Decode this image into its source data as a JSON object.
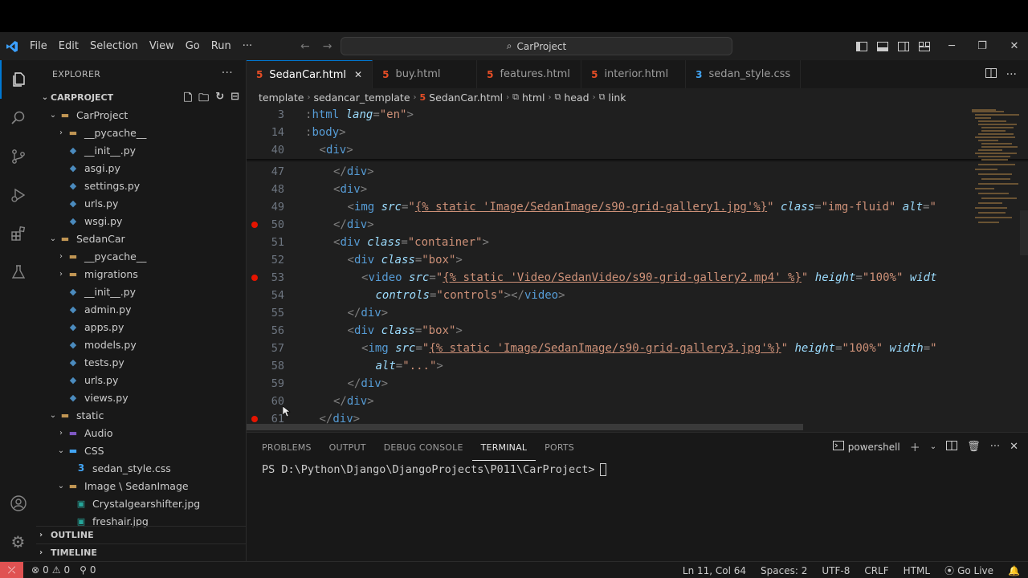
{
  "menu": [
    "File",
    "Edit",
    "Selection",
    "View",
    "Go",
    "Run",
    "···"
  ],
  "search": {
    "text": "CarProject"
  },
  "explorer": {
    "title": "EXPLORER",
    "root": "CARPROJECT",
    "tree": [
      {
        "label": "CarProject",
        "type": "folder",
        "indent": 1,
        "open": true
      },
      {
        "label": "__pycache__",
        "type": "folder",
        "indent": 2,
        "open": false
      },
      {
        "label": "__init__.py",
        "type": "py",
        "indent": 2
      },
      {
        "label": "asgi.py",
        "type": "py",
        "indent": 2
      },
      {
        "label": "settings.py",
        "type": "py",
        "indent": 2
      },
      {
        "label": "urls.py",
        "type": "py",
        "indent": 2
      },
      {
        "label": "wsgi.py",
        "type": "py",
        "indent": 2
      },
      {
        "label": "SedanCar",
        "type": "folder",
        "indent": 1,
        "open": true
      },
      {
        "label": "__pycache__",
        "type": "folder",
        "indent": 2,
        "open": false
      },
      {
        "label": "migrations",
        "type": "folder",
        "indent": 2,
        "open": false
      },
      {
        "label": "__init__.py",
        "type": "py",
        "indent": 2
      },
      {
        "label": "admin.py",
        "type": "py",
        "indent": 2
      },
      {
        "label": "apps.py",
        "type": "py",
        "indent": 2
      },
      {
        "label": "models.py",
        "type": "py",
        "indent": 2
      },
      {
        "label": "tests.py",
        "type": "py",
        "indent": 2
      },
      {
        "label": "urls.py",
        "type": "py",
        "indent": 2
      },
      {
        "label": "views.py",
        "type": "py",
        "indent": 2
      },
      {
        "label": "static",
        "type": "folder",
        "indent": 1,
        "open": true
      },
      {
        "label": "Audio",
        "type": "audio",
        "indent": 2,
        "open": false
      },
      {
        "label": "CSS",
        "type": "cssfolder",
        "indent": 2,
        "open": true
      },
      {
        "label": "sedan_style.css",
        "type": "css",
        "indent": 3
      },
      {
        "label": "Image \\ SedanImage",
        "type": "folder",
        "indent": 2,
        "open": true
      },
      {
        "label": "Crystalgearshifter.jpg",
        "type": "img",
        "indent": 3
      },
      {
        "label": "freshair.jpg",
        "type": "img",
        "indent": 3
      }
    ],
    "outline": "OUTLINE",
    "timeline": "TIMELINE"
  },
  "tabs": [
    {
      "label": "SedanCar.html",
      "type": "html",
      "active": true
    },
    {
      "label": "buy.html",
      "type": "html",
      "active": false
    },
    {
      "label": "features.html",
      "type": "html",
      "active": false
    },
    {
      "label": "interior.html",
      "type": "html",
      "active": false
    },
    {
      "label": "sedan_style.css",
      "type": "css",
      "active": false
    }
  ],
  "breadcrumbs": [
    "template",
    "sedancar_template",
    "SedanCar.html",
    "html",
    "head",
    "link"
  ],
  "code_lines": [
    {
      "n": "3",
      "sticky": true,
      "indent": 0,
      "parts": [
        [
          "pn",
          ":"
        ],
        [
          "tag",
          "html "
        ],
        [
          "attr",
          "lang"
        ],
        [
          "pn",
          "="
        ],
        [
          "str",
          "\"en\""
        ],
        [
          "pn",
          ">"
        ]
      ]
    },
    {
      "n": "14",
      "sticky": true,
      "indent": 0,
      "parts": [
        [
          "pn",
          ":"
        ],
        [
          "tag",
          "body"
        ],
        [
          "pn",
          ">"
        ]
      ]
    },
    {
      "n": "40",
      "sticky": true,
      "indent": 1,
      "parts": [
        [
          "pn",
          "<"
        ],
        [
          "tag",
          "div"
        ],
        [
          "pn",
          ">"
        ]
      ]
    },
    {
      "n": "47",
      "indent": 2,
      "parts": [
        [
          "pn",
          "</"
        ],
        [
          "tag",
          "div"
        ],
        [
          "pn",
          ">"
        ]
      ]
    },
    {
      "n": "48",
      "indent": 2,
      "parts": [
        [
          "pn",
          "<"
        ],
        [
          "tag",
          "div"
        ],
        [
          "pn",
          ">"
        ]
      ]
    },
    {
      "n": "49",
      "indent": 3,
      "parts": [
        [
          "pn",
          "<"
        ],
        [
          "tag",
          "img "
        ],
        [
          "attr",
          "src"
        ],
        [
          "pn",
          "="
        ],
        [
          "str",
          "\""
        ],
        [
          "tmpl",
          "{% static 'Image/SedanImage/s90-grid-gallery1.jpg'%}"
        ],
        [
          "str",
          "\""
        ],
        [
          "pn",
          " "
        ],
        [
          "attr",
          "class"
        ],
        [
          "pn",
          "="
        ],
        [
          "str",
          "\"img-fluid\""
        ],
        [
          "pn",
          " "
        ],
        [
          "attr",
          "alt"
        ],
        [
          "pn",
          "="
        ],
        [
          "str",
          "\""
        ]
      ]
    },
    {
      "n": "50",
      "bp": true,
      "indent": 2,
      "parts": [
        [
          "pn",
          "</"
        ],
        [
          "tag",
          "div"
        ],
        [
          "pn",
          ">"
        ]
      ]
    },
    {
      "n": "51",
      "indent": 2,
      "parts": [
        [
          "pn",
          "<"
        ],
        [
          "tag",
          "div "
        ],
        [
          "attr",
          "class"
        ],
        [
          "pn",
          "="
        ],
        [
          "str",
          "\"container\""
        ],
        [
          "pn",
          ">"
        ]
      ]
    },
    {
      "n": "52",
      "indent": 3,
      "parts": [
        [
          "pn",
          "<"
        ],
        [
          "tag",
          "div "
        ],
        [
          "attr",
          "class"
        ],
        [
          "pn",
          "="
        ],
        [
          "str",
          "\"box\""
        ],
        [
          "pn",
          ">"
        ]
      ]
    },
    {
      "n": "53",
      "bp": true,
      "indent": 4,
      "parts": [
        [
          "pn",
          "<"
        ],
        [
          "tag",
          "video "
        ],
        [
          "attr",
          "src"
        ],
        [
          "pn",
          "="
        ],
        [
          "str",
          "\""
        ],
        [
          "tmpl",
          "{% static 'Video/SedanVideo/s90-grid-gallery2.mp4' %}"
        ],
        [
          "str",
          "\""
        ],
        [
          "pn",
          " "
        ],
        [
          "attr",
          "height"
        ],
        [
          "pn",
          "="
        ],
        [
          "str",
          "\"100%\""
        ],
        [
          "pn",
          " "
        ],
        [
          "attr",
          "widt"
        ]
      ]
    },
    {
      "n": "54",
      "indent": 5,
      "parts": [
        [
          "attr",
          "controls"
        ],
        [
          "pn",
          "="
        ],
        [
          "str",
          "\"controls\""
        ],
        [
          "pn",
          "></"
        ],
        [
          "tag",
          "video"
        ],
        [
          "pn",
          ">"
        ]
      ]
    },
    {
      "n": "55",
      "indent": 3,
      "parts": [
        [
          "pn",
          "</"
        ],
        [
          "tag",
          "div"
        ],
        [
          "pn",
          ">"
        ]
      ]
    },
    {
      "n": "56",
      "indent": 3,
      "parts": [
        [
          "pn",
          "<"
        ],
        [
          "tag",
          "div "
        ],
        [
          "attr",
          "class"
        ],
        [
          "pn",
          "="
        ],
        [
          "str",
          "\"box\""
        ],
        [
          "pn",
          ">"
        ]
      ]
    },
    {
      "n": "57",
      "indent": 4,
      "parts": [
        [
          "pn",
          "<"
        ],
        [
          "tag",
          "img "
        ],
        [
          "attr",
          "src"
        ],
        [
          "pn",
          "="
        ],
        [
          "str",
          "\""
        ],
        [
          "tmpl",
          "{% static 'Image/SedanImage/s90-grid-gallery3.jpg'%}"
        ],
        [
          "str",
          "\""
        ],
        [
          "pn",
          " "
        ],
        [
          "attr",
          "height"
        ],
        [
          "pn",
          "="
        ],
        [
          "str",
          "\"100%\""
        ],
        [
          "pn",
          " "
        ],
        [
          "attr",
          "width"
        ],
        [
          "pn",
          "="
        ],
        [
          "str",
          "\""
        ]
      ]
    },
    {
      "n": "58",
      "indent": 5,
      "parts": [
        [
          "attr",
          "alt"
        ],
        [
          "pn",
          "="
        ],
        [
          "str",
          "\"...\""
        ],
        [
          "pn",
          ">"
        ]
      ]
    },
    {
      "n": "59",
      "indent": 3,
      "parts": [
        [
          "pn",
          "</"
        ],
        [
          "tag",
          "div"
        ],
        [
          "pn",
          ">"
        ]
      ]
    },
    {
      "n": "60",
      "indent": 2,
      "parts": [
        [
          "pn",
          "</"
        ],
        [
          "tag",
          "div"
        ],
        [
          "pn",
          ">"
        ]
      ]
    },
    {
      "n": "61",
      "bp": true,
      "indent": 1,
      "parts": [
        [
          "pn",
          "</"
        ],
        [
          "tag",
          "div"
        ],
        [
          "pn",
          ">"
        ]
      ]
    }
  ],
  "panel": {
    "tabs": [
      {
        "label": "PROBLEMS",
        "active": false
      },
      {
        "label": "OUTPUT",
        "active": false
      },
      {
        "label": "DEBUG CONSOLE",
        "active": false
      },
      {
        "label": "TERMINAL",
        "active": true
      },
      {
        "label": "PORTS",
        "active": false
      }
    ],
    "shell": "powershell",
    "prompt": "PS D:\\Python\\Django\\DjangoProjects\\P011\\CarProject>"
  },
  "status": {
    "errors": "0",
    "warnings": "0",
    "ports": "0",
    "position": "Ln 11, Col 64",
    "spaces": "Spaces: 2",
    "encoding": "UTF-8",
    "eol": "CRLF",
    "language": "HTML",
    "golive": "Go Live"
  },
  "colors": {
    "accent": "#0078d4",
    "breakpoint": "#e51400",
    "remote": "#e05252"
  }
}
